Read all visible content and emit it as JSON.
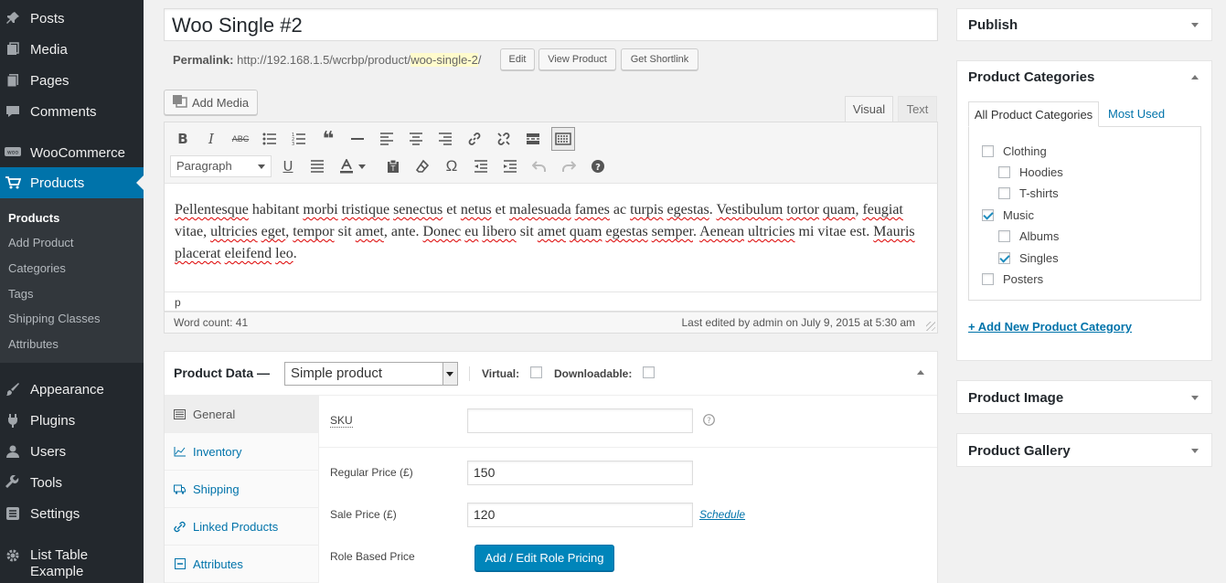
{
  "sidebar": {
    "items": [
      {
        "label": "Posts",
        "icon": "pin-icon"
      },
      {
        "label": "Media",
        "icon": "media-icon"
      },
      {
        "label": "Pages",
        "icon": "pages-icon"
      },
      {
        "label": "Comments",
        "icon": "comments-icon"
      },
      {
        "label": "WooCommerce",
        "icon": "woo-icon"
      },
      {
        "label": "Products",
        "icon": "cart-icon"
      },
      {
        "label": "Appearance",
        "icon": "brush-icon"
      },
      {
        "label": "Plugins",
        "icon": "plugin-icon"
      },
      {
        "label": "Users",
        "icon": "users-icon"
      },
      {
        "label": "Tools",
        "icon": "wrench-icon"
      },
      {
        "label": "Settings",
        "icon": "settings-icon"
      },
      {
        "label": "List Table Example",
        "icon": "gear-icon"
      }
    ],
    "submenu": [
      "Products",
      "Add Product",
      "Categories",
      "Tags",
      "Shipping Classes",
      "Attributes"
    ]
  },
  "post": {
    "title": "Woo Single #2",
    "permalink_label": "Permalink:",
    "permalink_base": "http://192.168.1.5/wcrbp/product/",
    "permalink_slug": "woo-single-2",
    "permalink_tail": "/",
    "edit_btn": "Edit",
    "view_btn": "View Product",
    "shortlink_btn": "Get Shortlink"
  },
  "editor": {
    "add_media": "Add Media",
    "tab_visual": "Visual",
    "tab_text": "Text",
    "format": "Paragraph",
    "content_segments": [
      {
        "t": "Pellentesque",
        "s": true
      },
      {
        "t": " habitant ",
        "s": false
      },
      {
        "t": "morbi",
        "s": true
      },
      {
        "t": " ",
        "s": false
      },
      {
        "t": "tristique",
        "s": true
      },
      {
        "t": " ",
        "s": false
      },
      {
        "t": "senectus",
        "s": true
      },
      {
        "t": " et ",
        "s": false
      },
      {
        "t": "netus",
        "s": true
      },
      {
        "t": " et ",
        "s": false
      },
      {
        "t": "malesuada",
        "s": true
      },
      {
        "t": " ",
        "s": false
      },
      {
        "t": "fames",
        "s": true
      },
      {
        "t": " ac ",
        "s": false
      },
      {
        "t": "turpis",
        "s": true
      },
      {
        "t": " ",
        "s": false
      },
      {
        "t": "egestas",
        "s": true
      },
      {
        "t": ". ",
        "s": false
      },
      {
        "t": "Vestibulum",
        "s": true
      },
      {
        "t": " ",
        "s": false
      },
      {
        "t": "tortor",
        "s": true
      },
      {
        "t": " ",
        "s": false
      },
      {
        "t": "quam",
        "s": true
      },
      {
        "t": ", ",
        "s": false
      },
      {
        "t": "feugiat",
        "s": true
      },
      {
        "t": " vitae, ",
        "s": false
      },
      {
        "t": "ultricies",
        "s": true
      },
      {
        "t": " ",
        "s": false
      },
      {
        "t": "eget",
        "s": true
      },
      {
        "t": ", ",
        "s": false
      },
      {
        "t": "tempor",
        "s": true
      },
      {
        "t": " sit ",
        "s": false
      },
      {
        "t": "amet",
        "s": true
      },
      {
        "t": ", ante. ",
        "s": false
      },
      {
        "t": "Donec",
        "s": true
      },
      {
        "t": " ",
        "s": false
      },
      {
        "t": "eu",
        "s": true
      },
      {
        "t": " ",
        "s": false
      },
      {
        "t": "libero",
        "s": true
      },
      {
        "t": " sit ",
        "s": false
      },
      {
        "t": "amet",
        "s": true
      },
      {
        "t": " ",
        "s": false
      },
      {
        "t": "quam",
        "s": true
      },
      {
        "t": " ",
        "s": false
      },
      {
        "t": "egestas",
        "s": true
      },
      {
        "t": " ",
        "s": false
      },
      {
        "t": "semper",
        "s": true
      },
      {
        "t": ". ",
        "s": false
      },
      {
        "t": "Aenean",
        "s": true
      },
      {
        "t": " ",
        "s": false
      },
      {
        "t": "ultricies",
        "s": true
      },
      {
        "t": " mi vitae est. ",
        "s": false
      },
      {
        "t": "Mauris",
        "s": true
      },
      {
        "t": " ",
        "s": false
      },
      {
        "t": "placerat",
        "s": true
      },
      {
        "t": " ",
        "s": false
      },
      {
        "t": "eleifend",
        "s": true
      },
      {
        "t": " ",
        "s": false
      },
      {
        "t": "leo",
        "s": true
      },
      {
        "t": ".",
        "s": false
      }
    ],
    "path": "p",
    "word_count": "Word count: 41",
    "last_edited": "Last edited by admin on July 9, 2015 at 5:30 am"
  },
  "product_data": {
    "title": "Product Data —",
    "type": "Simple product",
    "virtual_label": "Virtual:",
    "downloadable_label": "Downloadable:",
    "tabs": [
      "General",
      "Inventory",
      "Shipping",
      "Linked Products",
      "Attributes"
    ],
    "sku_label": "SKU",
    "sku_value": "",
    "regular_price_label": "Regular Price (£)",
    "regular_price": "150",
    "sale_price_label": "Sale Price (£)",
    "sale_price": "120",
    "schedule": "Schedule",
    "role_label": "Role Based Price",
    "role_btn": "Add / Edit Role Pricing"
  },
  "right": {
    "publish": "Publish",
    "categories_title": "Product Categories",
    "tab_all": "All Product Categories",
    "tab_used": "Most Used",
    "categories": [
      {
        "label": "Clothing",
        "checked": false,
        "level": 0
      },
      {
        "label": "Hoodies",
        "checked": false,
        "level": 1
      },
      {
        "label": "T-shirts",
        "checked": false,
        "level": 1
      },
      {
        "label": "Music",
        "checked": true,
        "level": 0
      },
      {
        "label": "Albums",
        "checked": false,
        "level": 1
      },
      {
        "label": "Singles",
        "checked": true,
        "level": 1
      },
      {
        "label": "Posters",
        "checked": false,
        "level": 0
      }
    ],
    "add_category": "+ Add New Product Category",
    "product_image": "Product Image",
    "product_gallery": "Product Gallery"
  },
  "colors": {
    "admin_bar": "#23282d",
    "accent": "#0073aa",
    "button_primary": "#0085ba"
  }
}
